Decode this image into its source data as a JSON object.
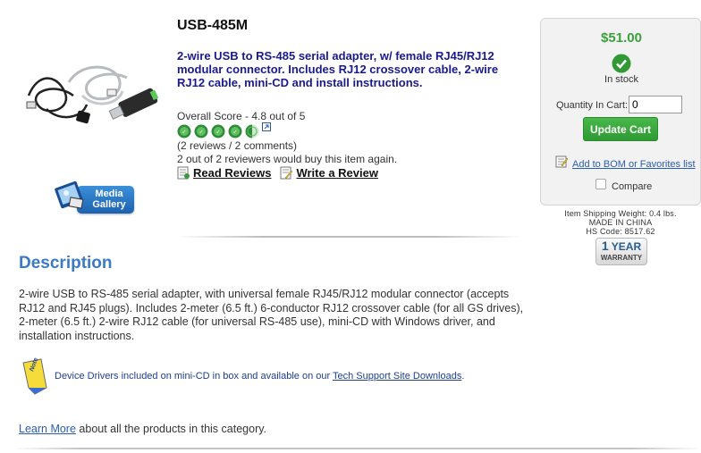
{
  "product": {
    "title": "USB-485M",
    "subtitle": "2-wire USB to RS-485 serial adapter, w/ female RJ45/RJ12 modular connector. Includes RJ12 crossover cable, 2-wire RJ12 cable, mini-CD and install instructions.",
    "image_icon": "usb-adapter-with-cables-image"
  },
  "media_gallery": {
    "label_line1": "Media",
    "label_line2": "Gallery"
  },
  "rating": {
    "score_text": "Overall Score - 4.8 out of 5",
    "score": 4.8,
    "max": 5,
    "reviews_text": "(2 reviews / 2 comments)",
    "would_buy_text": "2 out of 2 reviewers would buy this item again."
  },
  "review_links": {
    "read": "Read Reviews",
    "write": "Write a Review"
  },
  "cart": {
    "price": "$51.00",
    "stock_status": "In stock",
    "qty_label": "Quantity In Cart:",
    "qty_value": "0",
    "update_button": "Update Cart",
    "bom_link": "Add to BOM or Favorites list",
    "compare_label": "Compare",
    "compare_checked": false
  },
  "shipping": {
    "weight": "Item Shipping Weight: 0.4 lbs.",
    "origin": "MADE IN CHINA",
    "hs_code": "HS Code: 8517.62"
  },
  "warranty": {
    "line1_num": "1",
    "line1_word": "YEAR",
    "line2": "WARRANTY"
  },
  "description": {
    "heading": "Description",
    "text": "2-wire USB to RS-485 serial adapter, with universal female RJ45/RJ12 modular connector (accepts RJ12 and RJ45 plugs). Includes 2-meter (6.5 ft.) 6-conductor RJ12 crossover cable (for all GS drives), 2-meter (6.5 ft.) 2-wire RJ12 cable (for universal RS-485 use), mini-CD with Windows driver, and installation instructions."
  },
  "note": {
    "icon_label": "Note",
    "text_before": "Device Drivers included on mini-CD in box and available on our ",
    "link": "Tech Support Site Downloads",
    "text_after": "."
  },
  "footer": {
    "learn_more_link": "Learn More",
    "learn_more_rest": " about all the products in this category."
  },
  "colors": {
    "price_green": "#3aa23a",
    "heading_blue": "#3a7bc4",
    "subtitle_navy": "#1a1a8c",
    "link_blue": "#2a5db0"
  }
}
